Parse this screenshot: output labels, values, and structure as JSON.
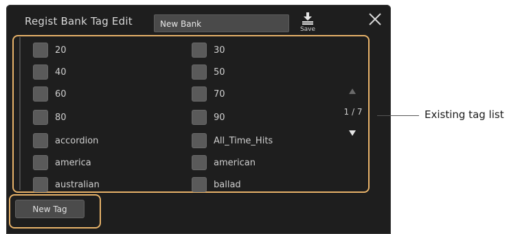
{
  "dialog": {
    "title": "Regist Bank Tag Edit",
    "bank_name": "New Bank",
    "save_label": "Save",
    "close_icon": "close-icon",
    "save_icon": "save-icon"
  },
  "tags": {
    "left_column": [
      "20",
      "40",
      "60",
      "80",
      "accordion",
      "america",
      "australian"
    ],
    "right_column": [
      "30",
      "50",
      "70",
      "90",
      "All_Time_Hits",
      "american",
      "ballad"
    ],
    "checked": []
  },
  "pagination": {
    "indicator": "1 / 7",
    "up_icon": "triangle-up-icon",
    "down_icon": "triangle-down-icon"
  },
  "buttons": {
    "new_tag": "New Tag"
  },
  "annotation": {
    "existing_tag_list": "Existing tag list"
  },
  "colors": {
    "panel_bg": "#1e1e1e",
    "highlight": "#e8b36a",
    "checkbox": "#5a5a5a"
  }
}
